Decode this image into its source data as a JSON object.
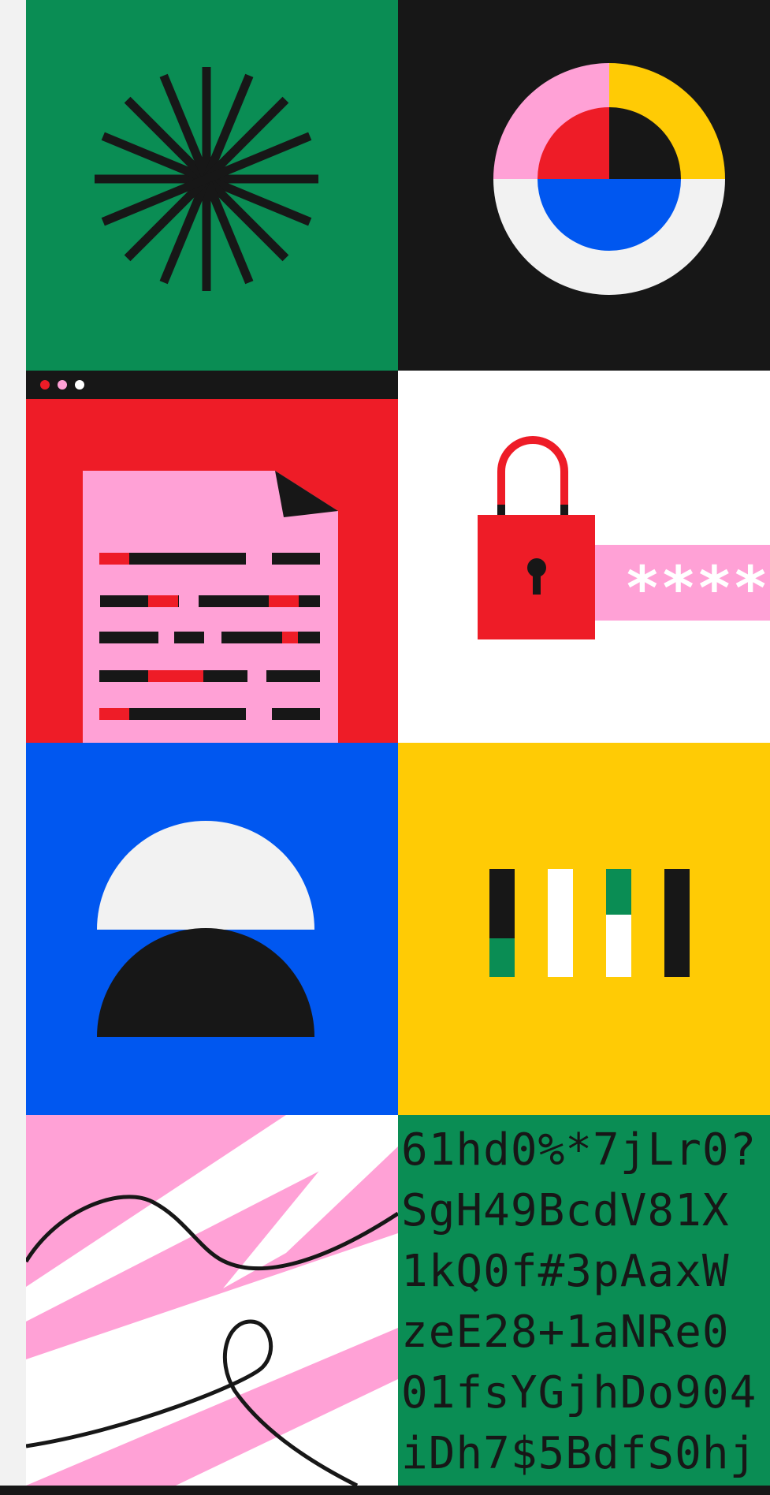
{
  "palette": {
    "green": "#0a8d54",
    "black": "#171717",
    "pink": "#ffa1d6",
    "yellow": "#ffcb05",
    "red": "#ee1c27",
    "blue": "#0057f0",
    "light": "#f2f2f2",
    "white": "#ffffff"
  },
  "tiles": [
    {
      "name": "starburst-tile",
      "icon": "starburst-icon"
    },
    {
      "name": "donut-tile",
      "icon": "quartered-donut-icon"
    },
    {
      "name": "document-window-tile",
      "icon": "redacted-document-icon"
    },
    {
      "name": "lock-password-tile",
      "icon": "padlock-icon"
    },
    {
      "name": "half-circles-tile",
      "icon": "half-circles-icon"
    },
    {
      "name": "bars-tile",
      "icon": "vertical-bars-icon"
    },
    {
      "name": "squiggle-tile",
      "icon": "squiggle-lines-icon"
    },
    {
      "name": "random-code-tile",
      "icon": "code-text-icon"
    }
  ],
  "password_field": {
    "masked_value": "****"
  },
  "random_code": {
    "lines": [
      "61hd0%*7jLr0?",
      "SgH49BcdV81X",
      "1kQ0f#3pAaxW",
      "zeE28+1aNRe0",
      "01fsYGjhDo904",
      "iDh7$5BdfS0hj"
    ]
  }
}
